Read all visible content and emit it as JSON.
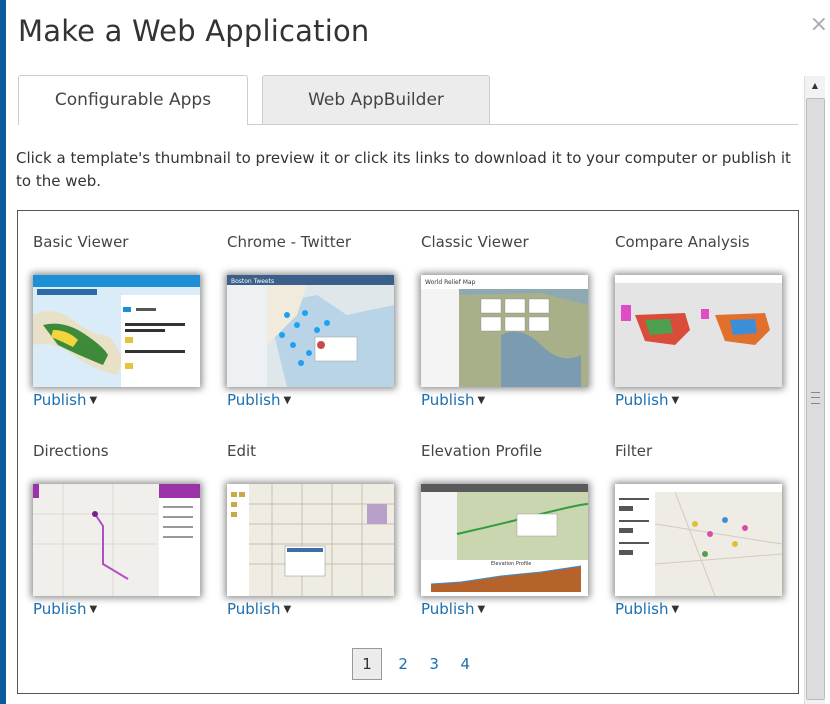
{
  "dialog": {
    "title": "Make a Web Application",
    "close_glyph": "×"
  },
  "tabs": [
    {
      "label": "Configurable Apps",
      "active": true
    },
    {
      "label": "Web AppBuilder",
      "active": false
    }
  ],
  "instructions": "Click a template's thumbnail to preview it or click its links to download it to your computer or publish it to the web.",
  "apps": [
    {
      "name": "Basic Viewer",
      "publish_label": "Publish"
    },
    {
      "name": "Chrome - Twitter",
      "publish_label": "Publish"
    },
    {
      "name": "Classic Viewer",
      "publish_label": "Publish"
    },
    {
      "name": "Compare Analysis",
      "publish_label": "Publish"
    },
    {
      "name": "Directions",
      "publish_label": "Publish"
    },
    {
      "name": "Edit",
      "publish_label": "Publish"
    },
    {
      "name": "Elevation Profile",
      "publish_label": "Publish"
    },
    {
      "name": "Filter",
      "publish_label": "Publish"
    }
  ],
  "thumbnail_text": {
    "chrome_twitter_header": "Boston Tweets",
    "classic_viewer_header": "World Relief Map",
    "elevation_chart_title": "Elevation Profile"
  },
  "pagination": {
    "current": "1",
    "pages": [
      "2",
      "3",
      "4"
    ]
  },
  "icons": {
    "publish_caret": "▼",
    "scroll_up": "▲"
  },
  "colors": {
    "link": "#1a6fb0",
    "frame": "#0a5a9c"
  }
}
